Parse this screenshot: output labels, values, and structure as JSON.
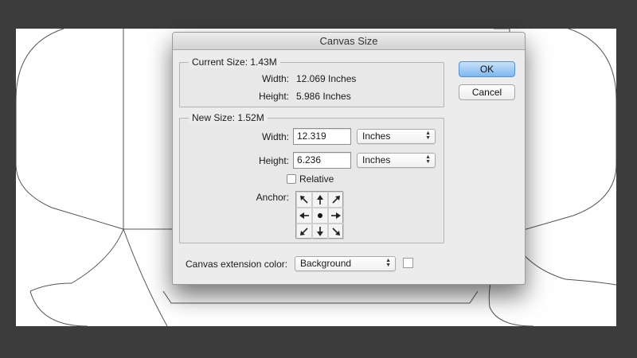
{
  "dialog": {
    "title": "Canvas Size"
  },
  "current_size": {
    "legend": "Current Size: 1.43M",
    "width_label": "Width:",
    "width_value": "12.069 Inches",
    "height_label": "Height:",
    "height_value": "5.986 Inches"
  },
  "new_size": {
    "legend": "New Size: 1.52M",
    "width_label": "Width:",
    "width_value": "12.319",
    "width_unit": "Inches",
    "height_label": "Height:",
    "height_value": "6.236",
    "height_unit": "Inches",
    "relative_label": "Relative",
    "relative_checked": false,
    "anchor_label": "Anchor:",
    "anchor_selected": "center",
    "anchor_icons": [
      "arrow-up-left-icon",
      "arrow-up-icon",
      "arrow-up-right-icon",
      "arrow-left-icon",
      "center-dot-icon",
      "arrow-right-icon",
      "arrow-down-left-icon",
      "arrow-down-icon",
      "arrow-down-right-icon"
    ]
  },
  "extension": {
    "label": "Canvas extension color:",
    "value": "Background",
    "swatch_color": "#ffffff"
  },
  "buttons": {
    "ok": "OK",
    "cancel": "Cancel"
  },
  "colors": {
    "ok_accent": "#7db7ef",
    "backdrop": "#3c3c3c"
  }
}
